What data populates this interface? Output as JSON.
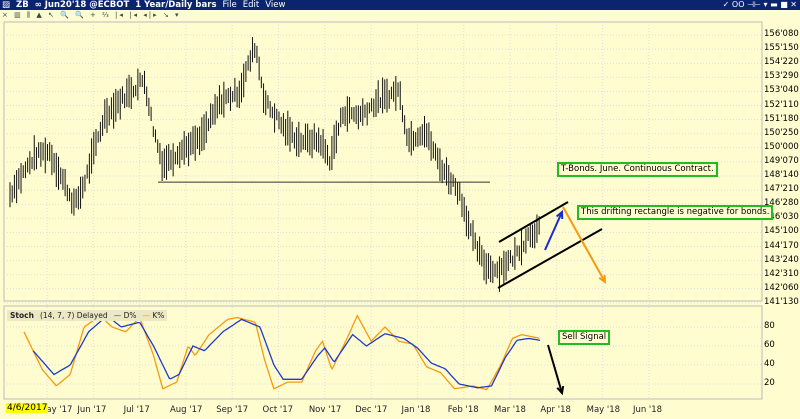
{
  "window": {
    "symbol": "ZB",
    "contract": "∞ Jun20'18 @ECBOT",
    "period": "1 Year/Daily bars",
    "menus": [
      "File",
      "Edit",
      "View"
    ],
    "controls": "✓ OO ⊣⊢ ▾  ▬ ■ ✕"
  },
  "toolbar": {
    "icons": "× ▥ ⫼ ▲ ↖ 🔍 🔍 + ⅔ |◂ |◂ ◂|▸ ↘ ▾"
  },
  "chart_data": [
    {
      "type": "bar",
      "title": "ZB ∞ Jun20'18 @ECBOT 1 Year/Daily bars",
      "ylim": [
        140.9,
        156.8
      ],
      "y_ticks": [
        "156'080",
        "155'150",
        "154'220",
        "153'290",
        "153'040",
        "152'110",
        "151'180",
        "150'250",
        "150'000",
        "149'070",
        "148'140",
        "147'210",
        "146'280",
        "146'030",
        "145'100",
        "144'170",
        "143'240",
        "142'310",
        "142'060",
        "141'130"
      ],
      "y_tick_values": [
        156.25,
        155.46875,
        154.6875,
        153.90625,
        153.125,
        152.34375,
        151.5625,
        150.78125,
        150,
        149.21875,
        148.4375,
        147.65625,
        146.875,
        146.09375,
        145.3125,
        144.53125,
        143.75,
        142.96875,
        142.1875,
        141.40625
      ],
      "x_ticks": [
        "May '17",
        "Jun '17",
        "Jul '17",
        "Aug '17",
        "Sep '17",
        "Oct '17",
        "Nov '17",
        "Dec '17",
        "Jan '18",
        "Feb '18",
        "Mar '18",
        "Apr '18",
        "May '18",
        "Jun '18"
      ],
      "start_date": "4/6/2017",
      "price_path_month_price": [
        [
          0,
          147.4
        ],
        [
          0.1,
          147.9
        ],
        [
          0.55,
          149.6
        ],
        [
          0.85,
          149.8
        ],
        [
          1.4,
          146.8
        ],
        [
          1.6,
          148.0
        ],
        [
          2.05,
          151.8
        ],
        [
          2.5,
          152.9
        ],
        [
          2.9,
          153.8
        ],
        [
          3.1,
          151.0
        ],
        [
          3.3,
          149.1
        ],
        [
          3.7,
          149.9
        ],
        [
          4.1,
          150.4
        ],
        [
          4.55,
          152.6
        ],
        [
          4.95,
          153.1
        ],
        [
          5.3,
          155.7
        ],
        [
          5.5,
          152.6
        ],
        [
          5.95,
          151.0
        ],
        [
          6.25,
          150.4
        ],
        [
          6.7,
          150.4
        ],
        [
          6.9,
          149.3
        ],
        [
          7.2,
          152.0
        ],
        [
          7.55,
          151.8
        ],
        [
          7.95,
          152.6
        ],
        [
          8.4,
          153.2
        ],
        [
          8.6,
          150.4
        ],
        [
          8.95,
          151.0
        ],
        [
          9.3,
          149.0
        ],
        [
          9.7,
          147.6
        ],
        [
          10.0,
          144.9
        ],
        [
          10.25,
          143.5
        ],
        [
          10.55,
          143.2
        ],
        [
          10.9,
          144.0
        ],
        [
          11.2,
          145.2
        ],
        [
          11.45,
          145.5
        ]
      ],
      "annotations": {
        "support_price": 148.1,
        "note1": "T-Bonds. June. Continuous Contract.",
        "note2": "This drifting rectangle is negative for bonds."
      }
    },
    {
      "type": "line",
      "title": "Stoch",
      "params": "(14, 7, 7) Delayed",
      "legend": [
        "D%",
        "K%"
      ],
      "ylim": [
        0,
        100
      ],
      "y_ticks": [
        "80",
        "60",
        "40",
        "20"
      ],
      "y_tick_values": [
        80,
        60,
        40,
        20
      ],
      "colors": {
        "D%": "#1e3cc8",
        "K%": "#f59a10"
      },
      "K_month_value": [
        [
          0.3,
          75
        ],
        [
          0.7,
          35
        ],
        [
          1.0,
          18
        ],
        [
          1.3,
          30
        ],
        [
          1.6,
          80
        ],
        [
          1.95,
          92
        ],
        [
          2.2,
          80
        ],
        [
          2.5,
          75
        ],
        [
          2.8,
          90
        ],
        [
          3.1,
          50
        ],
        [
          3.3,
          15
        ],
        [
          3.6,
          22
        ],
        [
          3.85,
          60
        ],
        [
          4.0,
          50
        ],
        [
          4.3,
          72
        ],
        [
          4.7,
          88
        ],
        [
          4.9,
          90
        ],
        [
          5.3,
          85
        ],
        [
          5.5,
          45
        ],
        [
          5.7,
          15
        ],
        [
          6.0,
          22
        ],
        [
          6.3,
          22
        ],
        [
          6.6,
          55
        ],
        [
          6.75,
          65
        ],
        [
          6.95,
          35
        ],
        [
          7.3,
          70
        ],
        [
          7.5,
          92
        ],
        [
          7.8,
          65
        ],
        [
          8.1,
          80
        ],
        [
          8.4,
          65
        ],
        [
          8.7,
          62
        ],
        [
          9.0,
          38
        ],
        [
          9.3,
          32
        ],
        [
          9.6,
          15
        ],
        [
          10.0,
          18
        ],
        [
          10.3,
          14
        ],
        [
          10.6,
          40
        ],
        [
          10.85,
          68
        ],
        [
          11.05,
          72
        ],
        [
          11.45,
          68
        ]
      ],
      "D_month_value": [
        [
          0.5,
          55
        ],
        [
          0.95,
          30
        ],
        [
          1.3,
          40
        ],
        [
          1.7,
          75
        ],
        [
          2.1,
          92
        ],
        [
          2.4,
          80
        ],
        [
          2.8,
          85
        ],
        [
          3.1,
          60
        ],
        [
          3.45,
          25
        ],
        [
          3.65,
          30
        ],
        [
          3.95,
          60
        ],
        [
          4.2,
          55
        ],
        [
          4.6,
          75
        ],
        [
          5.0,
          88
        ],
        [
          5.4,
          80
        ],
        [
          5.7,
          40
        ],
        [
          5.9,
          25
        ],
        [
          6.3,
          25
        ],
        [
          6.65,
          50
        ],
        [
          6.8,
          58
        ],
        [
          7.0,
          43
        ],
        [
          7.4,
          72
        ],
        [
          7.7,
          60
        ],
        [
          8.1,
          73
        ],
        [
          8.5,
          68
        ],
        [
          8.8,
          58
        ],
        [
          9.1,
          42
        ],
        [
          9.4,
          36
        ],
        [
          9.7,
          20
        ],
        [
          10.1,
          16
        ],
        [
          10.4,
          18
        ],
        [
          10.7,
          48
        ],
        [
          10.95,
          66
        ],
        [
          11.2,
          68
        ],
        [
          11.45,
          66
        ]
      ],
      "annotation": "Sell Signal"
    }
  ]
}
